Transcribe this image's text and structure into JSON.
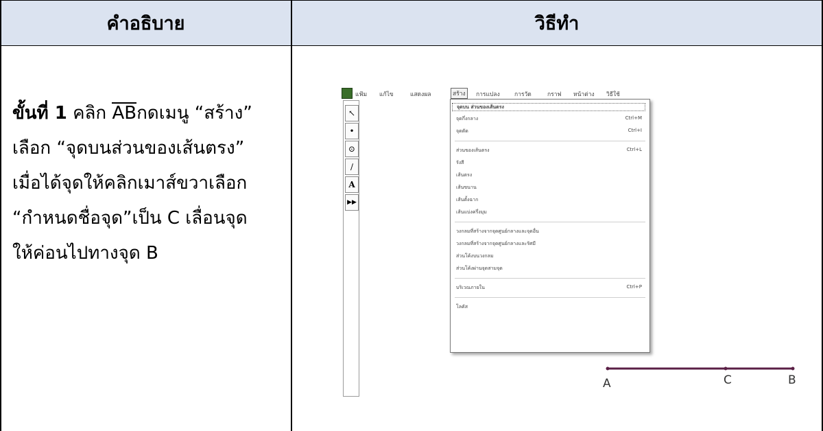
{
  "headers": {
    "left": "คำอธิบาย",
    "right": "วิธีทำ"
  },
  "description": {
    "step_label": "ขั้นที่ 1",
    "line1_pre": "คลิก",
    "segment": "AB",
    "line1_post": "กดเมนู “สร้าง”",
    "line2": "เลือก “จุดบนส่วนของเส้นตรง”",
    "line3": "เมื่อได้จุดให้คลิกเมาส์ขวาเลือก",
    "line4": "“กำหนดชื่อจุด”เป็น C  เลื่อนจุด",
    "line5": "ให้ค่อนไปทางจุด B"
  },
  "screenshot": {
    "menubar": [
      "แฟ้ม",
      "แก้ไข",
      "แสดงผล",
      "สร้าง",
      "การแปลง",
      "การวัด",
      "กราฟ",
      "หน้าต่าง",
      "วิธีใช้"
    ],
    "active_menu": "สร้าง",
    "tools": [
      "↖",
      "•",
      "⊙",
      "∕",
      "A",
      "▶▶"
    ],
    "menu_items": [
      {
        "label": "จุดบน ส่วนของเส้นตรง",
        "shortcut": ""
      },
      {
        "label": "จุดกึ่งกลาง",
        "shortcut": "Ctrl+M"
      },
      {
        "label": "จุดตัด",
        "shortcut": "Ctrl+I"
      },
      {
        "label": "ส่วนของเส้นตรง",
        "shortcut": "Ctrl+L"
      },
      {
        "label": "รังสี",
        "shortcut": ""
      },
      {
        "label": "เส้นตรง",
        "shortcut": ""
      },
      {
        "label": "เส้นขนาน",
        "shortcut": ""
      },
      {
        "label": "เส้นตั้งฉาก",
        "shortcut": ""
      },
      {
        "label": "เส้นแบ่งครึ่งมุม",
        "shortcut": ""
      },
      {
        "label": "วงกลมที่สร้างจากจุดศูนย์กลางและจุดอื่น",
        "shortcut": ""
      },
      {
        "label": "วงกลมที่สร้างจากจุดศูนย์กลางและรัศมี",
        "shortcut": ""
      },
      {
        "label": "ส่วนโค้งบนวงกลม",
        "shortcut": ""
      },
      {
        "label": "ส่วนโค้งผ่านจุดสามจุด",
        "shortcut": ""
      },
      {
        "label": "บริเวณภายใน",
        "shortcut": "Ctrl+P"
      },
      {
        "label": "โลคัส",
        "shortcut": ""
      }
    ],
    "points": {
      "a": "A",
      "c": "C",
      "b": "B"
    },
    "segment_color": "#5a1f45"
  }
}
